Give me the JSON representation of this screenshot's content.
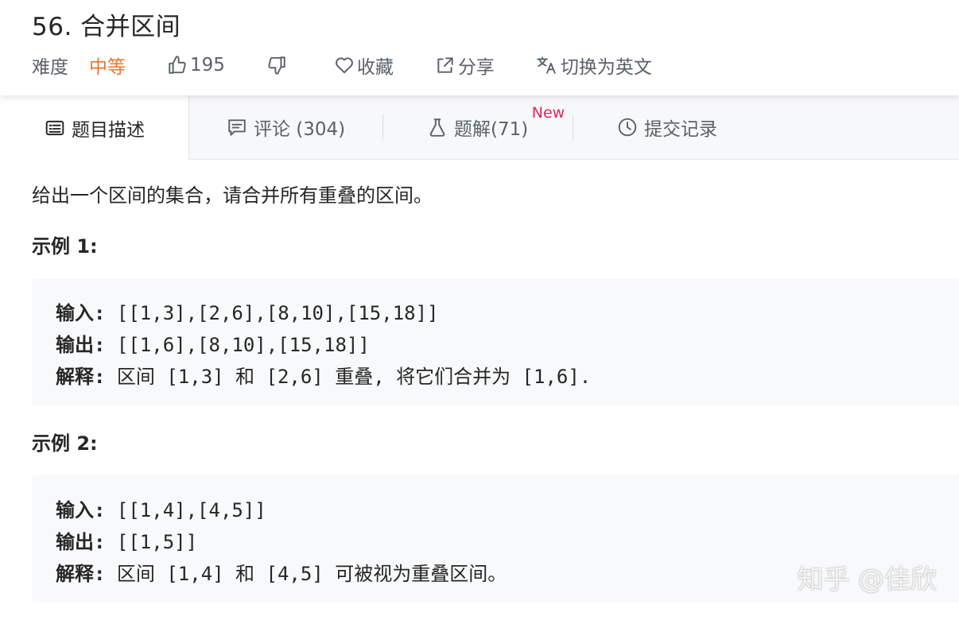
{
  "problem": {
    "title": "56. 合并区间",
    "difficulty_label": "难度",
    "difficulty_value": "中等",
    "likes": "195",
    "favorite_label": "收藏",
    "share_label": "分享",
    "translate_label": "切换为英文"
  },
  "tabs": [
    {
      "label": "题目描述",
      "icon": "description-icon",
      "active": true
    },
    {
      "label": "评论 (304)",
      "icon": "comment-icon",
      "active": false
    },
    {
      "label": "题解(71)",
      "icon": "flask-icon",
      "active": false,
      "badge": "New"
    },
    {
      "label": "提交记录",
      "icon": "clock-icon",
      "active": false
    }
  ],
  "content": {
    "description": "给出一个区间的集合，请合并所有重叠的区间。",
    "examples": [
      {
        "title": "示例 1:",
        "input_label": "输入:",
        "input": "[[1,3],[2,6],[8,10],[15,18]]",
        "output_label": "输出:",
        "output": "[[1,6],[8,10],[15,18]]",
        "explain_label": "解释:",
        "explanation": "区间 [1,3] 和 [2,6] 重叠, 将它们合并为 [1,6]."
      },
      {
        "title": "示例 2:",
        "input_label": "输入:",
        "input": "[[1,4],[4,5]]",
        "output_label": "输出:",
        "output": "[[1,5]]",
        "explain_label": "解释:",
        "explanation": "区间 [1,4] 和 [4,5] 可被视为重叠区间。"
      }
    ]
  },
  "watermark": "知乎 @佳欣",
  "colors": {
    "difficulty_medium": "#e8762b",
    "new_badge": "#e6245c",
    "code_bg": "#f7f9fa",
    "tab_bar_bg": "#f7f8fa"
  }
}
